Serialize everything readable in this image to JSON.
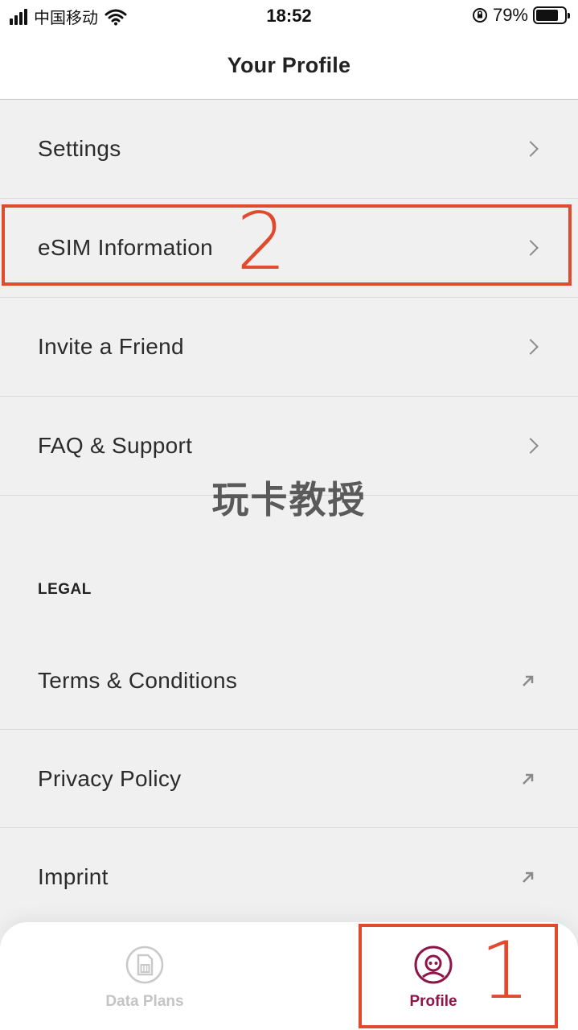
{
  "status_bar": {
    "carrier": "中国移动",
    "time": "18:52",
    "battery": "79%",
    "battery_level": 0.79
  },
  "header": {
    "title": "Your Profile"
  },
  "menu": [
    {
      "label": "Settings",
      "icon": "chevron-right-icon"
    },
    {
      "label": "eSIM Information",
      "icon": "chevron-right-icon"
    },
    {
      "label": "Invite a Friend",
      "icon": "chevron-right-icon"
    },
    {
      "label": "FAQ & Support",
      "icon": "chevron-right-icon"
    }
  ],
  "legal": {
    "title": "LEGAL",
    "items": [
      {
        "label": "Terms & Conditions",
        "icon": "external-link-icon"
      },
      {
        "label": "Privacy Policy",
        "icon": "external-link-icon"
      },
      {
        "label": "Imprint",
        "icon": "external-link-icon"
      }
    ]
  },
  "watermark": "玩卡教授",
  "annotations": {
    "step1": "1",
    "step2": "2",
    "color": "#e04a2f"
  },
  "tabs": [
    {
      "label": "Data Plans",
      "icon": "sim-card-icon",
      "active": false,
      "color": "#c4c4c4"
    },
    {
      "label": "Profile",
      "icon": "profile-face-icon",
      "active": true,
      "color": "#8e1548"
    }
  ]
}
